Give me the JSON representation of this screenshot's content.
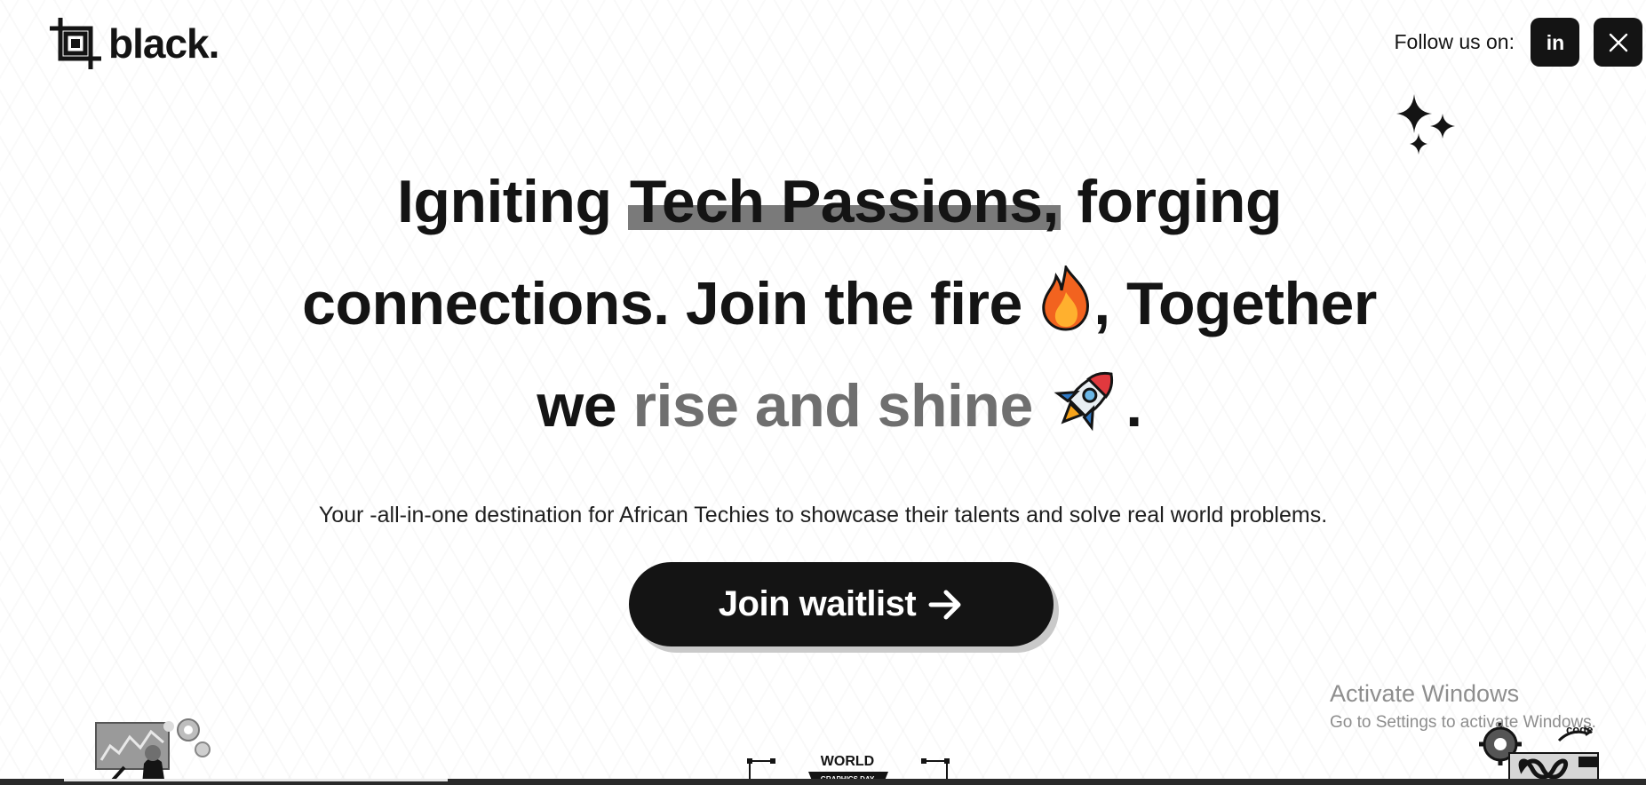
{
  "brand": {
    "name": "black.",
    "logo_icon": "crop-frame-icon"
  },
  "social": {
    "label": "Follow us on:",
    "links": [
      {
        "name": "linkedin",
        "icon": "linkedin-icon",
        "glyph": "in"
      },
      {
        "name": "x",
        "icon": "x-twitter-icon"
      }
    ]
  },
  "hero": {
    "line1_pre": "Igniting ",
    "line1_highlight": "Tech Passions,",
    "line1_post": " forging",
    "line2_pre": "connections. Join the fire ",
    "line2_post": ", Together",
    "line3_pre": "we ",
    "line3_muted": "rise and shine",
    "line3_post": ".",
    "emoji_1": "fire-emoji-icon",
    "emoji_2": "rocket-emoji-icon"
  },
  "subtitle": "Your -all-in-one destination for African Techies to showcase their talents and solve real world problems.",
  "cta": {
    "label": "Join waitlist",
    "icon": "arrow-right-icon"
  },
  "illustrations": {
    "mid_title": "WORLD",
    "mid_subtitle": "GRAPHICS DAY",
    "right_label": "code"
  },
  "os_watermark": {
    "title": "Activate Windows",
    "subtitle": "Go to Settings to activate Windows."
  },
  "colors": {
    "primary": "#141414",
    "muted_text": "#6f6f6f",
    "highlight": "#7a7a7a",
    "background": "#ffffff"
  }
}
